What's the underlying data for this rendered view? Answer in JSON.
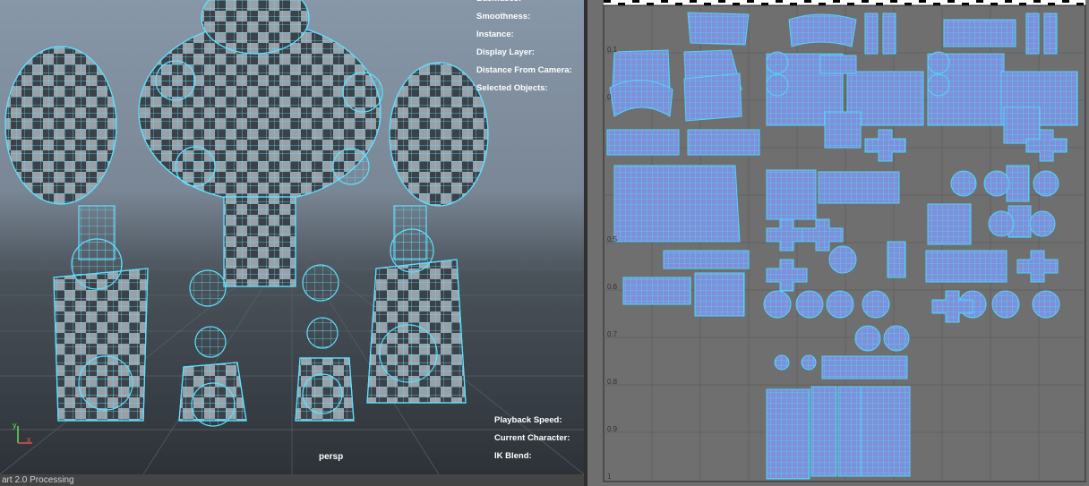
{
  "viewport": {
    "camera": "persp",
    "hud_top": [
      "Backfaces:",
      "Smoothness:",
      "Instance:",
      "Display Layer:",
      "Distance From Camera:",
      "Selected Objects:"
    ],
    "hud_bottom": [
      "Playback Speed:",
      "Current Character:",
      "IK Blend:"
    ],
    "axis_labels": {
      "y": "y",
      "x": "x"
    }
  },
  "status_bar": {
    "text": "art 2.0 Processing"
  },
  "uv_editor": {
    "v_ticks": [
      "0.1",
      "0",
      "0.5",
      "0.6",
      "0.7",
      "0.8",
      "0.9",
      "1"
    ]
  },
  "colors": {
    "wire": "#5fe0ff",
    "uv_shell": "#7f8fd8",
    "uv_grid_bg": "#6f6f6f"
  }
}
